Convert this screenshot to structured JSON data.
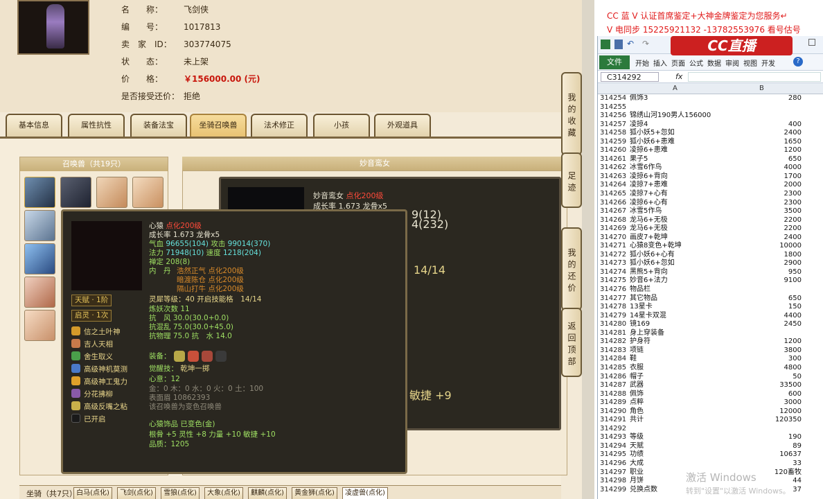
{
  "game": {
    "info": [
      {
        "k": "名　　称：",
        "v": "飞剑侠"
      },
      {
        "k": "编　　号：",
        "v": "1017813"
      },
      {
        "k": "卖　家　ID：",
        "v": "303774075"
      },
      {
        "k": "状　　态：",
        "v": "未上架"
      },
      {
        "k": "价　　格：",
        "v": "￥156000.00 (元)"
      },
      {
        "k": "是否接受还价：",
        "v": "拒绝"
      }
    ],
    "tabs": [
      "基本信息",
      "属性抗性",
      "装备法宝",
      "坐骑召唤兽",
      "法术修正",
      "小孩",
      "外观道具"
    ],
    "summon_panel_title": "召唤兽（共19只）",
    "main_panel_title": "妙音鸾女",
    "detail": {
      "name": "妙音鸾女",
      "tag": "点化200级",
      "growth": "成长率 1.673 龙骨x5",
      "snip1": "9(12)",
      "snip2": "4(232)",
      "snip3": "14/14",
      "snip4": "敏捷 +9"
    },
    "tooltip": {
      "name": "心猿",
      "tag": "点化200级",
      "growth": "成长率 1.673 龙骨x5",
      "hp_label": "气血",
      "hp": "96655(104)",
      "atk_label": "攻击",
      "atk": "99014(370)",
      "mp_label": "法力",
      "mp": "71948(10)",
      "spd_label": "速度",
      "spd": "1218(204)",
      "zen": "禅定 208(8)",
      "neidan_label": "内　丹",
      "neidan": [
        "浩然正气 点化200级",
        "暗渡陈仓 点化200级",
        "隔山打牛 点化200级"
      ],
      "spirit": "灵犀等级：40 开启技能格　14/14",
      "refine": "炼妖次数 11",
      "res1": "抗　风 30.0(30.0+0.0)",
      "res2": "抗混乱 75.0(30.0+45.0)",
      "res3": "抗物理 75.0 抗　水 14.0",
      "badge1": "天赋 · 1阶",
      "badge2": "启灵 · 1次",
      "skills": [
        "信之土叶神",
        "吉人天相",
        "舍生取义",
        "高级神机莫测",
        "高级神工鬼力",
        "分花拂柳",
        "高级反嘴之粘",
        "已开启"
      ],
      "equip_label": "装备：",
      "awaken_label": "觉醒技：",
      "awaken": "乾坤一掷",
      "heart": "心意：12",
      "elements": "金：0 木：0 水：0 火：0 土：100",
      "appearance": "表面眉 10862393",
      "changed": "该召唤兽为变色召唤兽",
      "deco": "心猿饰品 已变色(金)",
      "bonus": "根骨 +5 灵性 +8 力量 +10 敏捷 +10",
      "quality": "品质：1205"
    },
    "side_buttons": [
      "我的收藏",
      "足迹",
      "我的还价",
      "返回顶部"
    ],
    "bottom": {
      "label": "坐骑（共7只）",
      "tabs": [
        "白马(点化)",
        "飞剑(点化)",
        "雪狼(点化)",
        "大象(点化)",
        "麒麟(点化)",
        "黄金狮(点化)",
        "凌虚兽(点化)"
      ]
    }
  },
  "overlay": {
    "line1": "CC 蓝 V 认证首席鉴定+大神金牌鉴定为您服务↵",
    "line2": "V 电同步 15225921132 -13782553976 看号估号"
  },
  "excel": {
    "logo": "CC直播",
    "file_tab": "文件",
    "ribbon_tabs": [
      "开始",
      "插入",
      "页面",
      "公式",
      "数据",
      "审阅",
      "视图",
      "开发"
    ],
    "name_box": "C314292",
    "fx": "fx",
    "col_a": "A",
    "col_b": "B",
    "rows": [
      [
        "314254",
        "佩饰3",
        "280"
      ],
      [
        "314255",
        "",
        ""
      ],
      [
        "314256",
        "锦绣山河190男人156000",
        ""
      ],
      [
        "314257",
        "凌掠4",
        "400"
      ],
      [
        "314258",
        "狐小妖5+忽如",
        "2400"
      ],
      [
        "314259",
        "狐小妖6+患难",
        "1650"
      ],
      [
        "314260",
        "凌掠6+患难",
        "1200"
      ],
      [
        "314261",
        "果子5",
        "650"
      ],
      [
        "314262",
        "冰雪6作鸟",
        "4000"
      ],
      [
        "314263",
        "凌掠6+背向",
        "1700"
      ],
      [
        "314264",
        "凌掠7+患难",
        "2000"
      ],
      [
        "314265",
        "凌掠7+心有",
        "2300"
      ],
      [
        "314266",
        "凌掠6+心有",
        "2300"
      ],
      [
        "314267",
        "冰雪5作鸟",
        "3500"
      ],
      [
        "314268",
        "龙马6+无极",
        "2200"
      ],
      [
        "314269",
        "龙马6+无极",
        "2200"
      ],
      [
        "314270",
        "画皮7+乾坤",
        "2400"
      ],
      [
        "314271",
        "心猿8变色+乾坤",
        "10000"
      ],
      [
        "314272",
        "狐小妖6+心有",
        "1800"
      ],
      [
        "314273",
        "狐小妖6+忽如",
        "2900"
      ],
      [
        "314274",
        "黑熊5+背向",
        "950"
      ],
      [
        "314275",
        "妙音6+法力",
        "9100"
      ],
      [
        "314276",
        "物品栏",
        ""
      ],
      [
        "314277",
        "其它物品",
        "650"
      ],
      [
        "314278",
        "13星卡",
        "150"
      ],
      [
        "314279",
        "14星卡双混",
        "4400"
      ],
      [
        "314280",
        "镜169",
        "2450"
      ],
      [
        "314281",
        "身上穿装备",
        ""
      ],
      [
        "314282",
        "护身符",
        "1200"
      ],
      [
        "314283",
        "项链",
        "3800"
      ],
      [
        "314284",
        "鞋",
        "300"
      ],
      [
        "314285",
        "衣服",
        "4800"
      ],
      [
        "314286",
        "帽子",
        "50"
      ],
      [
        "314287",
        "武器",
        "33500"
      ],
      [
        "314288",
        "佩饰",
        "600"
      ],
      [
        "314289",
        "点粹",
        "3000"
      ],
      [
        "314290",
        "角色",
        "12000"
      ],
      [
        "314291",
        "共计",
        "120350"
      ],
      [
        "314292",
        "",
        ""
      ],
      [
        "314293",
        "等级",
        "190"
      ],
      [
        "314294",
        "天赋",
        "89"
      ],
      [
        "314295",
        "功绩",
        "10637"
      ],
      [
        "314296",
        "大成",
        "33"
      ],
      [
        "314297",
        "职业",
        "120畜牧"
      ],
      [
        "314298",
        "月饼",
        "44"
      ],
      [
        "314299",
        "兑换点数",
        "37"
      ]
    ]
  },
  "watermark": {
    "line1": "激活 Windows",
    "line2": "转到\"设置\"以激活 Windows。"
  }
}
